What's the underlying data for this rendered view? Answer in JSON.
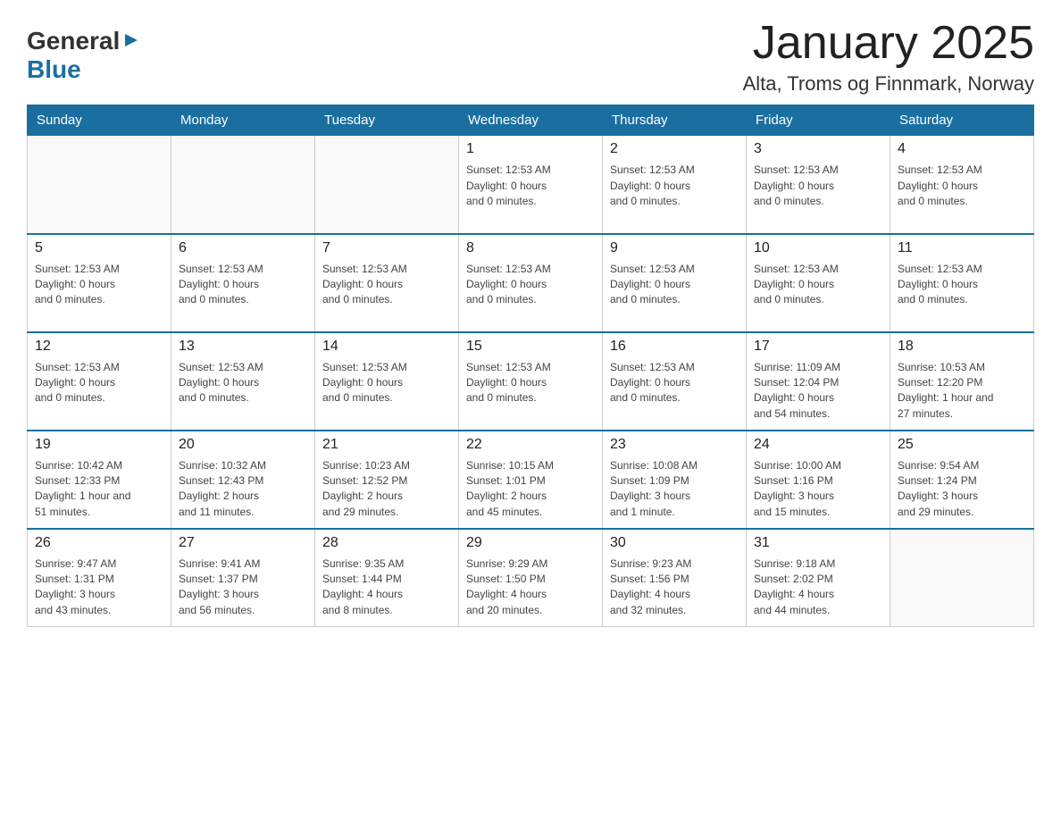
{
  "header": {
    "logo_general": "General",
    "logo_blue": "Blue",
    "title": "January 2025",
    "location": "Alta, Troms og Finnmark, Norway"
  },
  "days_of_week": [
    "Sunday",
    "Monday",
    "Tuesday",
    "Wednesday",
    "Thursday",
    "Friday",
    "Saturday"
  ],
  "weeks": [
    [
      {
        "day": "",
        "info": ""
      },
      {
        "day": "",
        "info": ""
      },
      {
        "day": "",
        "info": ""
      },
      {
        "day": "1",
        "info": "Sunset: 12:53 AM\nDaylight: 0 hours\nand 0 minutes."
      },
      {
        "day": "2",
        "info": "Sunset: 12:53 AM\nDaylight: 0 hours\nand 0 minutes."
      },
      {
        "day": "3",
        "info": "Sunset: 12:53 AM\nDaylight: 0 hours\nand 0 minutes."
      },
      {
        "day": "4",
        "info": "Sunset: 12:53 AM\nDaylight: 0 hours\nand 0 minutes."
      }
    ],
    [
      {
        "day": "5",
        "info": "Sunset: 12:53 AM\nDaylight: 0 hours\nand 0 minutes."
      },
      {
        "day": "6",
        "info": "Sunset: 12:53 AM\nDaylight: 0 hours\nand 0 minutes."
      },
      {
        "day": "7",
        "info": "Sunset: 12:53 AM\nDaylight: 0 hours\nand 0 minutes."
      },
      {
        "day": "8",
        "info": "Sunset: 12:53 AM\nDaylight: 0 hours\nand 0 minutes."
      },
      {
        "day": "9",
        "info": "Sunset: 12:53 AM\nDaylight: 0 hours\nand 0 minutes."
      },
      {
        "day": "10",
        "info": "Sunset: 12:53 AM\nDaylight: 0 hours\nand 0 minutes."
      },
      {
        "day": "11",
        "info": "Sunset: 12:53 AM\nDaylight: 0 hours\nand 0 minutes."
      }
    ],
    [
      {
        "day": "12",
        "info": "Sunset: 12:53 AM\nDaylight: 0 hours\nand 0 minutes."
      },
      {
        "day": "13",
        "info": "Sunset: 12:53 AM\nDaylight: 0 hours\nand 0 minutes."
      },
      {
        "day": "14",
        "info": "Sunset: 12:53 AM\nDaylight: 0 hours\nand 0 minutes."
      },
      {
        "day": "15",
        "info": "Sunset: 12:53 AM\nDaylight: 0 hours\nand 0 minutes."
      },
      {
        "day": "16",
        "info": "Sunset: 12:53 AM\nDaylight: 0 hours\nand 0 minutes."
      },
      {
        "day": "17",
        "info": "Sunrise: 11:09 AM\nSunset: 12:04 PM\nDaylight: 0 hours\nand 54 minutes."
      },
      {
        "day": "18",
        "info": "Sunrise: 10:53 AM\nSunset: 12:20 PM\nDaylight: 1 hour and\n27 minutes."
      }
    ],
    [
      {
        "day": "19",
        "info": "Sunrise: 10:42 AM\nSunset: 12:33 PM\nDaylight: 1 hour and\n51 minutes."
      },
      {
        "day": "20",
        "info": "Sunrise: 10:32 AM\nSunset: 12:43 PM\nDaylight: 2 hours\nand 11 minutes."
      },
      {
        "day": "21",
        "info": "Sunrise: 10:23 AM\nSunset: 12:52 PM\nDaylight: 2 hours\nand 29 minutes."
      },
      {
        "day": "22",
        "info": "Sunrise: 10:15 AM\nSunset: 1:01 PM\nDaylight: 2 hours\nand 45 minutes."
      },
      {
        "day": "23",
        "info": "Sunrise: 10:08 AM\nSunset: 1:09 PM\nDaylight: 3 hours\nand 1 minute."
      },
      {
        "day": "24",
        "info": "Sunrise: 10:00 AM\nSunset: 1:16 PM\nDaylight: 3 hours\nand 15 minutes."
      },
      {
        "day": "25",
        "info": "Sunrise: 9:54 AM\nSunset: 1:24 PM\nDaylight: 3 hours\nand 29 minutes."
      }
    ],
    [
      {
        "day": "26",
        "info": "Sunrise: 9:47 AM\nSunset: 1:31 PM\nDaylight: 3 hours\nand 43 minutes."
      },
      {
        "day": "27",
        "info": "Sunrise: 9:41 AM\nSunset: 1:37 PM\nDaylight: 3 hours\nand 56 minutes."
      },
      {
        "day": "28",
        "info": "Sunrise: 9:35 AM\nSunset: 1:44 PM\nDaylight: 4 hours\nand 8 minutes."
      },
      {
        "day": "29",
        "info": "Sunrise: 9:29 AM\nSunset: 1:50 PM\nDaylight: 4 hours\nand 20 minutes."
      },
      {
        "day": "30",
        "info": "Sunrise: 9:23 AM\nSunset: 1:56 PM\nDaylight: 4 hours\nand 32 minutes."
      },
      {
        "day": "31",
        "info": "Sunrise: 9:18 AM\nSunset: 2:02 PM\nDaylight: 4 hours\nand 44 minutes."
      },
      {
        "day": "",
        "info": ""
      }
    ]
  ]
}
